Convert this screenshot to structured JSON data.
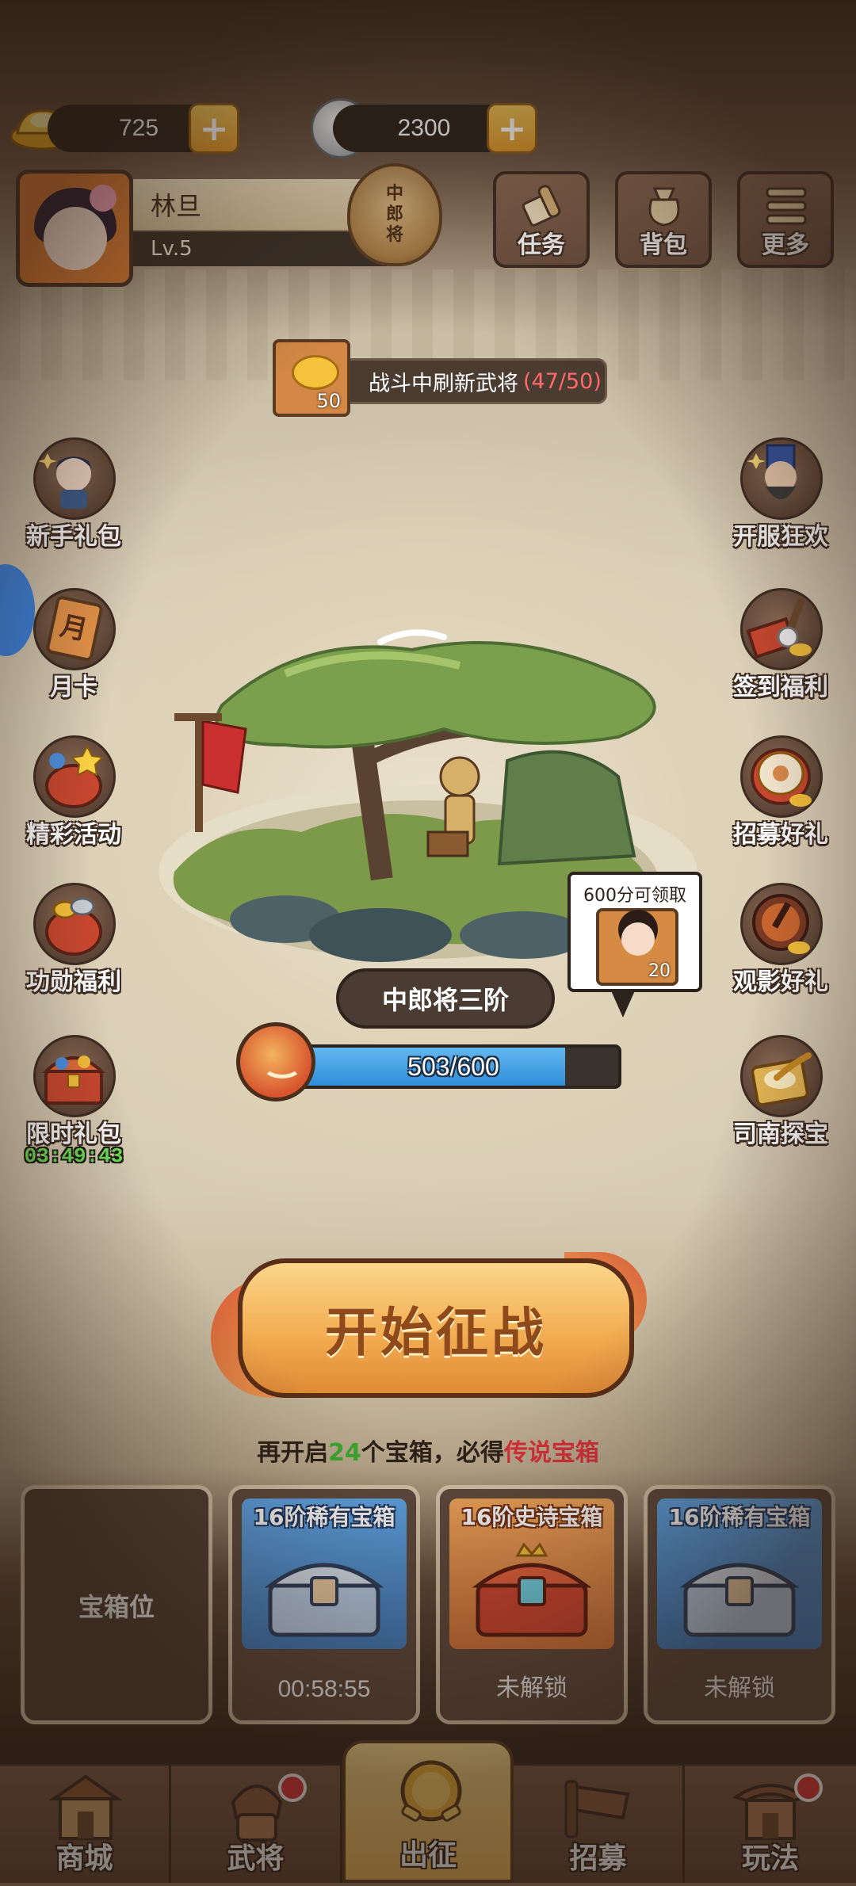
{
  "currency": {
    "gold": {
      "value": "725",
      "icon": "gold-ingot-icon"
    },
    "coin": {
      "value": "2300",
      "icon": "copper-coin-icon"
    },
    "plus_label": "+"
  },
  "profile": {
    "name": "林旦",
    "level": "Lv.5",
    "rank_badge": [
      "中",
      "郎",
      "将"
    ]
  },
  "top_buttons": [
    {
      "label": "任务",
      "icon": "scroll-icon"
    },
    {
      "label": "背包",
      "icon": "bag-icon"
    },
    {
      "label": "更多",
      "icon": "menu-icon"
    }
  ],
  "refresh_banner": {
    "icon_count": "50",
    "text": "战斗中刷新武将",
    "progress": "(47/50)"
  },
  "left_icons": [
    {
      "label": "新手礼包",
      "icon": "hero-pack-icon"
    },
    {
      "label": "月卡",
      "icon": "month-card-icon"
    },
    {
      "label": "精彩活动",
      "icon": "event-bag-icon"
    },
    {
      "label": "功勋福利",
      "icon": "merit-bag-icon"
    },
    {
      "label": "限时礼包",
      "icon": "treasure-chest-icon",
      "timer": "03:49:43"
    }
  ],
  "right_icons": [
    {
      "label": "开服狂欢",
      "icon": "general-portrait-icon"
    },
    {
      "label": "签到福利",
      "icon": "stamp-icon"
    },
    {
      "label": "招募好礼",
      "icon": "drum-icon"
    },
    {
      "label": "观影好礼",
      "icon": "video-gong-icon"
    },
    {
      "label": "司南探宝",
      "icon": "compass-icon"
    }
  ],
  "stage": {
    "rank_title": "中郎将三阶",
    "progress_text": "503/600",
    "progress_fraction": 0.8383,
    "claim": {
      "text": "600分可领取",
      "count": "20"
    }
  },
  "start_button": {
    "label": "开始征战"
  },
  "hint": {
    "prefix": "再开启",
    "count": "24",
    "middle": "个宝箱，必得",
    "reward": "传说宝箱"
  },
  "chests": [
    {
      "empty_label": "宝箱位"
    },
    {
      "title": "16阶稀有宝箱",
      "footer": "00:58:55",
      "tier": "rare"
    },
    {
      "title": "16阶史诗宝箱",
      "footer": "未解锁",
      "tier": "epic"
    },
    {
      "title": "16阶稀有宝箱",
      "footer": "未解锁",
      "tier": "rare"
    }
  ],
  "bottom_nav": [
    {
      "label": "商城",
      "icon": "shop-icon",
      "badge": false
    },
    {
      "label": "武将",
      "icon": "general-icon",
      "badge": true
    },
    {
      "label": "出征",
      "icon": "battle-gong-icon",
      "badge": false,
      "active": true
    },
    {
      "label": "招募",
      "icon": "recruit-banner-icon",
      "badge": false
    },
    {
      "label": "玩法",
      "icon": "pavilion-icon",
      "badge": true
    }
  ],
  "colors": {
    "accent_orange": "#f3ad52",
    "progress_blue": "#3f8fd8",
    "highlight_green": "#3da82f",
    "highlight_red": "#d8303a",
    "badge_red": "#e0353a"
  }
}
